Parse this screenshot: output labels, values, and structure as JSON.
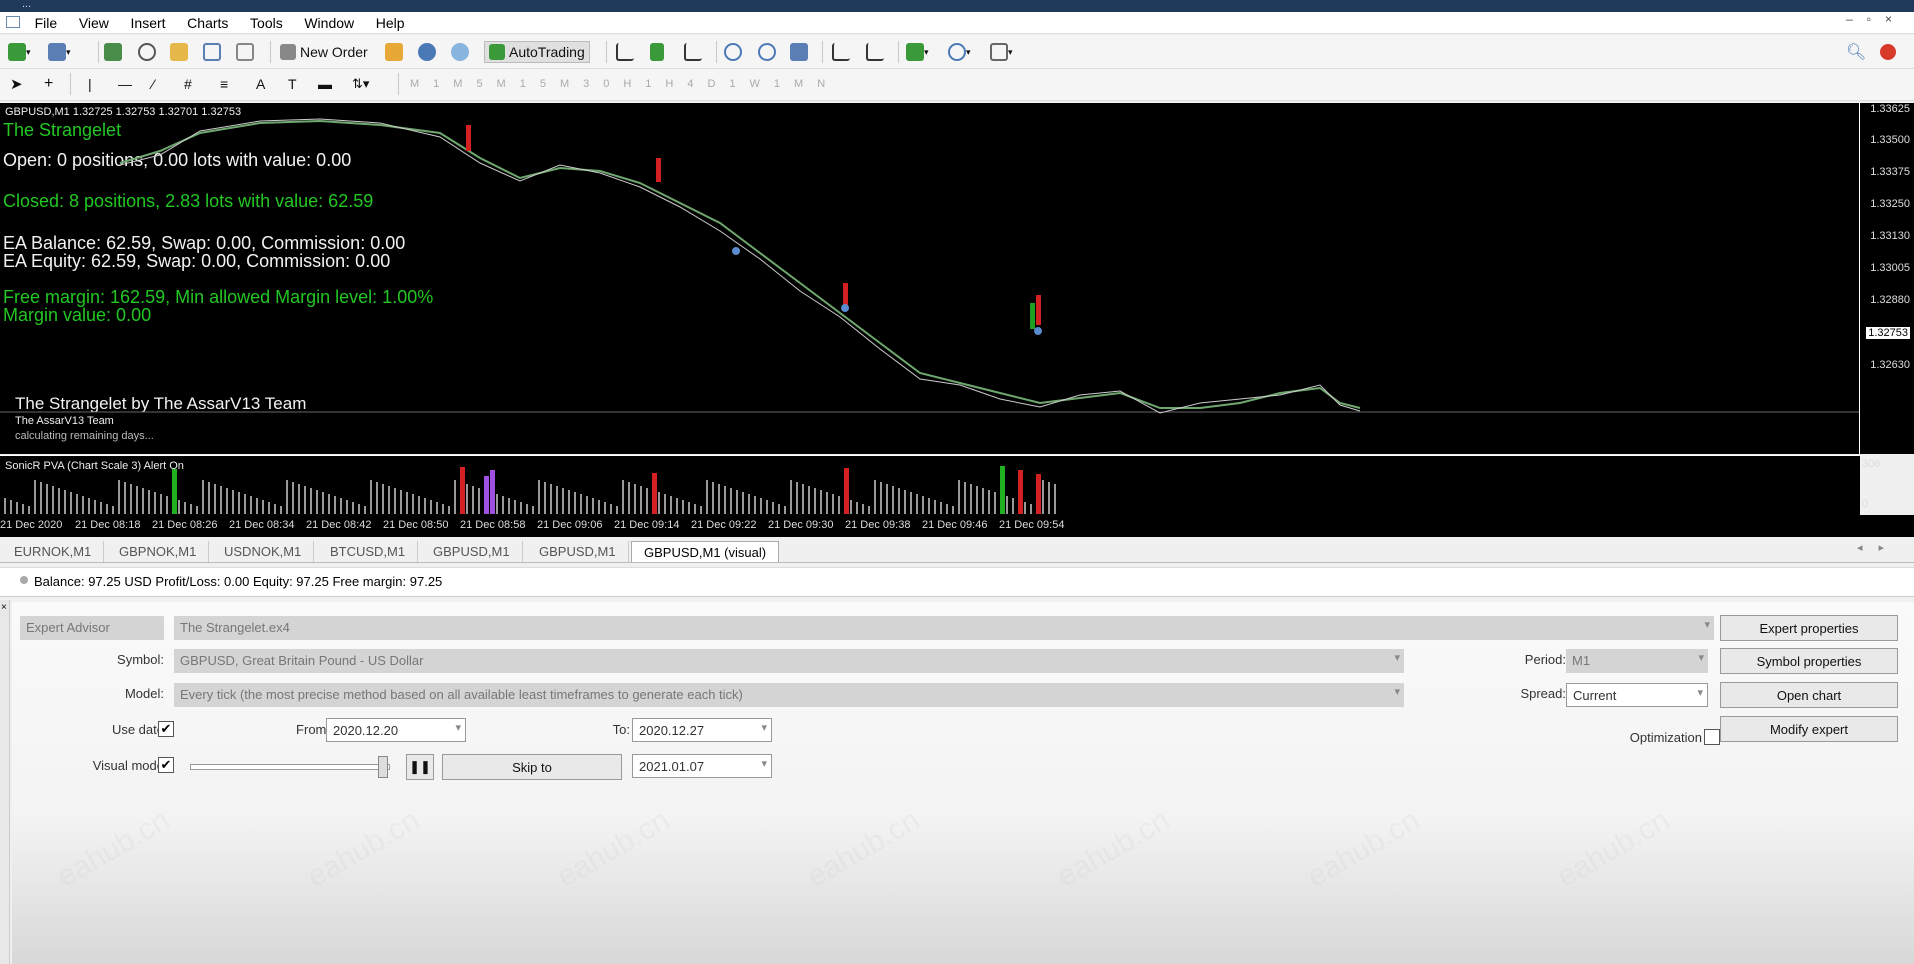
{
  "window": {
    "title": "..."
  },
  "menu": [
    "File",
    "View",
    "Insert",
    "Charts",
    "Tools",
    "Window",
    "Help"
  ],
  "toolbar": {
    "new_order": "New Order",
    "autotrading": "AutoTrading"
  },
  "chart": {
    "header": "GBPUSD,M1  1.32725 1.32753 1.32701 1.32753",
    "ea_name": "The Strangelet",
    "open_line": "Open: 0 positions, 0.00 lots with value: 0.00",
    "closed_line": "Closed: 8 positions, 2.83 lots with value: 62.59",
    "balance_line": "EA Balance: 62.59, Swap: 0.00, Commission: 0.00",
    "equity_line": "EA Equity: 62.59, Swap: 0.00, Commission: 0.00",
    "free_margin_line": "Free margin: 162.59, Min allowed Margin level: 1.00%",
    "margin_value_line": "Margin value: 0.00",
    "credit": "The Strangelet by The AssarV13 Team",
    "team": "The AssarV13 Team",
    "calc": "calculating remaining days...",
    "prices": [
      "1.33625",
      "1.33500",
      "1.33375",
      "1.33250",
      "1.33130",
      "1.33005",
      "1.32880",
      "1.32753",
      "1.32630"
    ],
    "current_price": "1.32753",
    "indicator_label": "SonicR PVA  (Chart Scale 3)   Alert On",
    "indicator_scale": [
      "306",
      "0"
    ],
    "times": [
      "21 Dec 2020",
      "21 Dec 08:18",
      "21 Dec 08:26",
      "21 Dec 08:34",
      "21 Dec 08:42",
      "21 Dec 08:50",
      "21 Dec 08:58",
      "21 Dec 09:06",
      "21 Dec 09:14",
      "21 Dec 09:22",
      "21 Dec 09:30",
      "21 Dec 09:38",
      "21 Dec 09:46",
      "21 Dec 09:54"
    ]
  },
  "tabs": [
    "EURNOK,M1",
    "GBPNOK,M1",
    "USDNOK,M1",
    "BTCUSD,M1",
    "GBPUSD,M1",
    "GBPUSD,M1",
    "GBPUSD,M1 (visual)"
  ],
  "status": "Balance: 97.25 USD  Profit/Loss: 0.00  Equity: 97.25  Free margin: 97.25",
  "tester": {
    "ea_label": "Expert Advisor",
    "ea_value": "The Strangelet.ex4",
    "symbol_label": "Symbol:",
    "symbol_value": "GBPUSD, Great Britain Pound - US Dollar",
    "model_label": "Model:",
    "model_value": "Every tick (the most precise method based on all available least timeframes to generate each tick)",
    "use_date_label": "Use date",
    "from_label": "From:",
    "from_value": "2020.12.20",
    "to_label": "To:",
    "to_value": "2020.12.27",
    "visual_label": "Visual mode",
    "skip_to": "Skip to",
    "skip_date": "2021.01.07",
    "period_label": "Period:",
    "period_value": "M1",
    "spread_label": "Spread:",
    "spread_value": "Current",
    "optimization_label": "Optimization",
    "btn_expert_props": "Expert properties",
    "btn_symbol_props": "Symbol properties",
    "btn_open_chart": "Open chart",
    "btn_modify_expert": "Modify expert",
    "check_mark": "✔"
  },
  "watermark": "eahub.cn"
}
